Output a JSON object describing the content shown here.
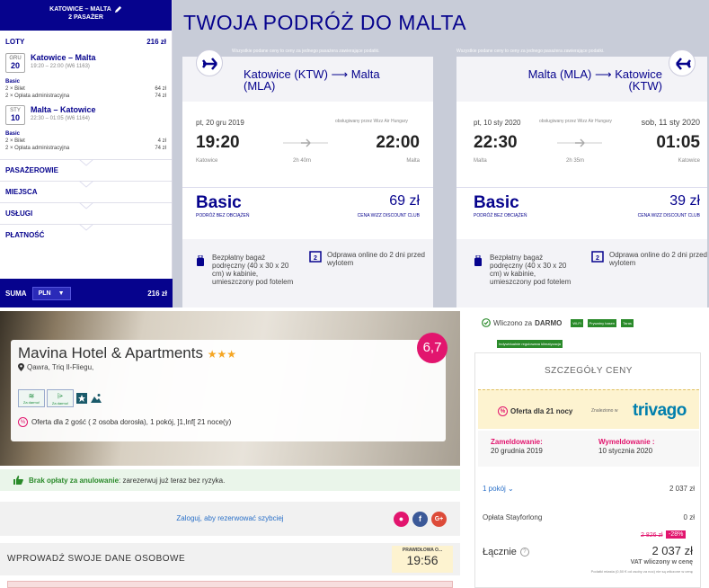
{
  "wizz": {
    "sidebar": {
      "route": "KATOWICE – MALTA",
      "pax": "2 PASAŻER",
      "loty_label": "LOTY",
      "loty_price": "216 zł",
      "flights": [
        {
          "month": "GRU",
          "day": "20",
          "route": "Katowice – Malta",
          "time": "19:20 – 22:00 (W6 1163)",
          "fare": "Basic",
          "line1": "2 × Bilet",
          "line1_price": "64 zł",
          "line2": "2 × Opłata administracyjna",
          "line2_price": "74 zł"
        },
        {
          "month": "STY",
          "day": "10",
          "route": "Malta – Katowice",
          "time": "22:30 – 01:05 (W6 1164)",
          "fare": "Basic",
          "line1": "2 × Bilet",
          "line1_price": "4 zł",
          "line2": "2 × Opłata administracyjna",
          "line2_price": "74 zł"
        }
      ],
      "sections": [
        "PASAŻEROWIE",
        "MIEJSCA",
        "USŁUGI",
        "PŁATNOŚĆ"
      ],
      "suma_label": "SUMA",
      "currency": "PLN",
      "suma_total": "216 zł"
    },
    "title": "TWOJA PODRÓŻ DO MALTA",
    "cards": [
      {
        "note": "Wszystkie podane ceny to ceny za jednego pasażera zawierające podatki.",
        "route": "Katowice (KTW) ⟶ Malta (MLA)",
        "date": "pt, 20 gru 2019",
        "operator": "obsługiwany przez Wizz Air Hungary",
        "dep": "19:20",
        "arr": "22:00",
        "from": "Katowice",
        "to": "Malta",
        "duration": "2h 40m",
        "fare": "Basic",
        "fare_sub": "PODRÓŻ BEZ OBCIĄŻEŃ",
        "price": "69 zł",
        "club": "CENA WIZZ DISCOUNT CLUB",
        "perk1": "Bezpłatny bagaż podręczny (40 x 30 x 20 cm) w kabinie, umieszczony pod fotelem",
        "perk2": "Odprawa online do 2 dni przed wylotem"
      },
      {
        "note": "Wszystkie podane ceny to ceny za jednego pasażera zawierające podatki.",
        "route": "Malta (MLA) ⟶ Katowice (KTW)",
        "date": "pt, 10 sty 2020",
        "operator": "obsługiwany przez Wizz Air Hungary",
        "arr_date": "sob, 11 sty 2020",
        "dep": "22:30",
        "arr": "01:05",
        "from": "Malta",
        "to": "Katowice",
        "duration": "2h 35m",
        "fare": "Basic",
        "fare_sub": "PODRÓŻ BEZ OBCIĄŻEŃ",
        "price": "39 zł",
        "club": "CENA WIZZ DISCOUNT CLUB",
        "perk1": "Bezpłatny bagaż podręczny (40 x 30 x 20 cm) w kabinie, umieszczony pod fotelem",
        "perk2": "Odprawa online do 2 dni przed wylotem"
      }
    ],
    "colors": {
      "brand": "#06038d",
      "accent": "#c6007e"
    }
  },
  "hotel": {
    "name": "Mavina Hotel & Apartments",
    "stars": "★★★",
    "address": "Qawra, Triq Il-Fliegu,",
    "score": "6,7",
    "amenities": [
      {
        "label": "Za darmo!",
        "icon": "wifi-icon"
      },
      {
        "label": "Za darmo!",
        "icon": "parking-icon"
      }
    ],
    "offer": "Oferta dla 2 gość ( 2 osoba dorosła), 1 pokój, ]1,Inf[ 21 noce(y)",
    "nocancel_bold": "Brak opłaty za anulowanie",
    "nocancel_rest": ": zarezerwuj już teraz bez ryzyka.",
    "login": "Zaloguj, aby rezerwować szybciej",
    "form_title": "WPROWADŹ SWOJE DANE OSOBOWE",
    "timer_label": "PRAWIDŁOWA O...",
    "timer_value": "19:56"
  },
  "pricebox": {
    "included_prefix": "Wliczono za",
    "included_bold": "DARMO",
    "tags": [
      "Wi-Fi",
      "Prywatny basen",
      "Taras"
    ],
    "tag2": "Indywidualnie regulowana klimatyzacja",
    "title": "SZCZEGÓŁY CENY",
    "offer": "Oferta dla 21 nocy",
    "found_in": "Znaleziono w",
    "trivago": "trivago",
    "checkin_label": "Zameldowanie:",
    "checkin": "20 grudnia 2019",
    "checkout_label": "Wymeldowanie :",
    "checkout": "10 stycznia 2020",
    "rooms_label": "1 pokój",
    "rooms_price": "2 037 zł",
    "fee_label": "Opłata Stayforlong",
    "fee": "0 zł",
    "old_price": "2 826 zł",
    "discount": "-28%",
    "total_label": "Łącznie",
    "total": "2 037 zł",
    "vat": "VAT wliczony w cenę",
    "tax_note": "Podatki miasta (0,50 € od osoby za noc) nie są wliczone w cenę"
  }
}
